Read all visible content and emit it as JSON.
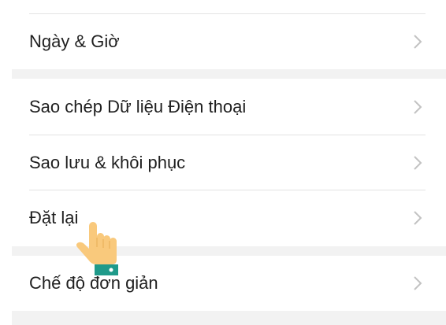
{
  "settings": {
    "items": [
      {
        "label": "Ngày & Giờ",
        "icon": "chevron-right-icon"
      },
      {
        "label": "Sao chép Dữ liệu Điện thoại",
        "icon": "chevron-right-icon"
      },
      {
        "label": "Sao lưu & khôi phục",
        "icon": "chevron-right-icon"
      },
      {
        "label": "Đặt lại",
        "icon": "chevron-right-icon"
      },
      {
        "label": "Chế độ đơn giản",
        "icon": "chevron-right-icon"
      }
    ]
  },
  "overlay": {
    "icon": "pointing-hand-icon"
  },
  "colors": {
    "background": "#ffffff",
    "section_gap": "#f2f2f2",
    "text": "#1f1f1f",
    "chevron": "#c2c2c2",
    "divider": "#e3e3e3",
    "hand_skin": "#f9c97c",
    "hand_cuff": "#1f9a8a"
  }
}
